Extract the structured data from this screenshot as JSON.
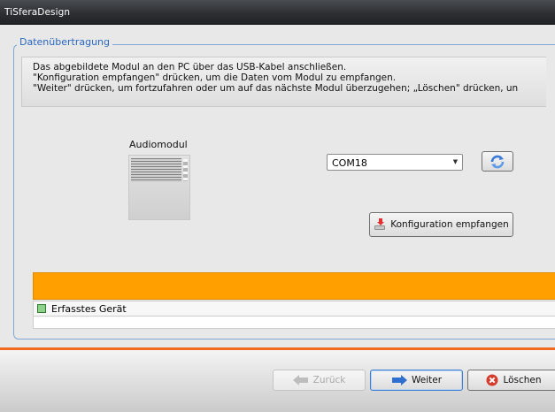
{
  "window": {
    "title": "TiSferaDesign"
  },
  "group": {
    "legend": "Datenübertragung"
  },
  "instructions": {
    "lines": [
      "Das abgebildete Modul an den PC über das USB-Kabel anschließen.",
      "\"Konfiguration empfangen\" drücken, um die Daten vom Modul zu empfangen.",
      "\"Weiter\" drücken, um fortzufahren oder um auf das nächste Modul überzugehen; „Löschen\" drücken, un"
    ]
  },
  "module": {
    "label": "Audiomodul"
  },
  "port": {
    "selected": "COM18"
  },
  "buttons": {
    "receive_label": "Konfiguration empfangen",
    "back_label": "Zurück",
    "next_label": "Weiter",
    "delete_label": "Löschen"
  },
  "progress": {
    "fraction": 1.0,
    "color": "#ffa000"
  },
  "device_list": {
    "header": "Erfasstes Gerät"
  },
  "colors": {
    "accent_blue": "#2a67c0",
    "footer_separator": "#f06a1f"
  },
  "icons": {
    "refresh": "refresh-icon",
    "receive": "receive-config-icon",
    "back": "arrow-left-icon",
    "next": "arrow-right-icon",
    "delete": "delete-icon",
    "device": "device-status-icon"
  }
}
